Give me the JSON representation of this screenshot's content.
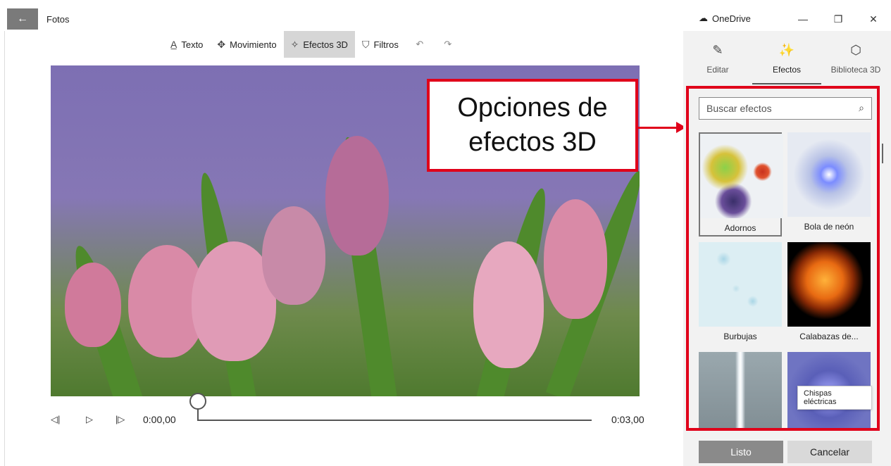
{
  "app": {
    "title": "Fotos",
    "onedrive_label": "OneDrive"
  },
  "window_controls": {
    "minimize": "—",
    "restore": "❐",
    "close": "✕"
  },
  "toolbar": {
    "items": [
      {
        "label": "Texto",
        "icon": "text-icon"
      },
      {
        "label": "Movimiento",
        "icon": "motion-icon"
      },
      {
        "label": "Efectos 3D",
        "icon": "3d-effects-icon",
        "active": true
      },
      {
        "label": "Filtros",
        "icon": "filter-icon"
      }
    ],
    "undo_icon": "undo-icon",
    "redo_icon": "redo-icon"
  },
  "callout": {
    "line1": "Opciones de",
    "line2": "efectos 3D"
  },
  "timeline": {
    "start_time": "0:00,00",
    "end_time": "0:03,00"
  },
  "panel": {
    "tabs": [
      {
        "label": "Editar",
        "icon": "pencil-icon"
      },
      {
        "label": "Efectos",
        "icon": "sparkle-icon",
        "active": true
      },
      {
        "label": "Biblioteca 3D",
        "icon": "cube-icon"
      }
    ],
    "search_placeholder": "Buscar efectos",
    "effects": [
      {
        "label": "Adornos",
        "selected": true
      },
      {
        "label": "Bola de neón"
      },
      {
        "label": "Burbujas"
      },
      {
        "label": "Calabazas de..."
      },
      {
        "label": ""
      },
      {
        "label": ""
      }
    ],
    "tooltip": "Chispas eléctricas",
    "done_label": "Listo",
    "cancel_label": "Cancelar"
  },
  "colors": {
    "accent_red": "#e0001a",
    "panel_bg": "#f2f2f2"
  }
}
